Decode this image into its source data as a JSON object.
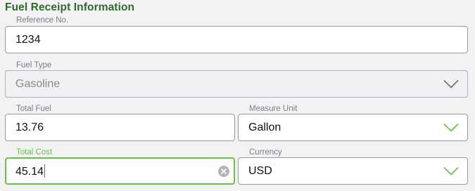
{
  "section": {
    "title": "Fuel Receipt Information"
  },
  "fields": {
    "reference": {
      "label": "Reference No.",
      "value": "1234"
    },
    "fuel_type": {
      "label": "Fuel Type",
      "value": "Gasoline",
      "disabled": true
    },
    "total_fuel": {
      "label": "Total Fuel",
      "value": "13.76"
    },
    "measure_unit": {
      "label": "Measure Unit",
      "value": "Gallon"
    },
    "total_cost": {
      "label": "Total Cost",
      "value": "45.14",
      "focused": true
    },
    "currency": {
      "label": "Currency",
      "value": "USD"
    }
  },
  "icons": {
    "dropdown": "chevron-down-icon",
    "clear": "clear-circle-icon"
  },
  "colors": {
    "title": "#2e6b2a",
    "accent_green": "#6cc04a",
    "chevron_disabled": "#6e6e72",
    "label_gray": "#7d7d82",
    "border_gray": "#9a9a9e"
  }
}
